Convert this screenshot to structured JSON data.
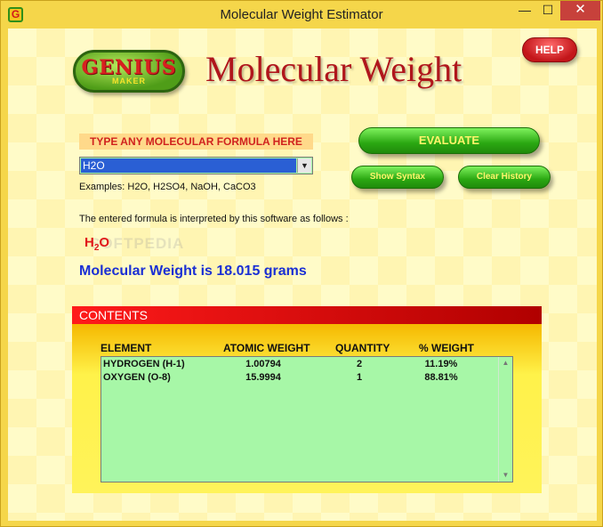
{
  "window": {
    "title": "Molecular Weight Estimator",
    "icon_letter": "G",
    "controls": {
      "minimize": "—",
      "maximize": "☐",
      "close": "✕"
    }
  },
  "logo": {
    "top": "GENIUS",
    "bottom": "MAKER"
  },
  "headline": "Molecular Weight",
  "help_label": "HELP",
  "prompt_label": "TYPE ANY MOLECULAR FORMULA HERE",
  "formula_input": {
    "value": "H2O",
    "dropdown_icon": "▼"
  },
  "examples": "Examples:  H2O, H2SO4, NaOH, CaCO3",
  "interpretation_text": "The entered formula is interpreted by this software as follows :",
  "formula_display": {
    "h": "H",
    "sub": "2",
    "o": "O"
  },
  "watermark": "SOFTPEDIA",
  "result": "Molecular Weight is 18.015 grams",
  "buttons": {
    "evaluate": "EVALUATE",
    "show_syntax": "Show Syntax",
    "clear_history": "Clear History"
  },
  "contents": {
    "title": "CONTENTS",
    "columns": [
      "ELEMENT",
      "ATOMIC WEIGHT",
      "QUANTITY",
      "% WEIGHT"
    ],
    "rows": [
      {
        "element": "HYDROGEN (H-1)",
        "atomic_weight": "1.00794",
        "quantity": "2",
        "pct_weight": "11.19%"
      },
      {
        "element": "OXYGEN (O-8)",
        "atomic_weight": "15.9994",
        "quantity": "1",
        "pct_weight": "88.81%"
      }
    ],
    "scroll_up": "▲",
    "scroll_down": "▼"
  },
  "colors": {
    "frame": "#f5d64a",
    "headline": "#b0161c",
    "result": "#1a2fd4",
    "button_green": "#2ba812",
    "contents_header": "#ff1a1a",
    "list_bg": "#a7f7a7"
  }
}
